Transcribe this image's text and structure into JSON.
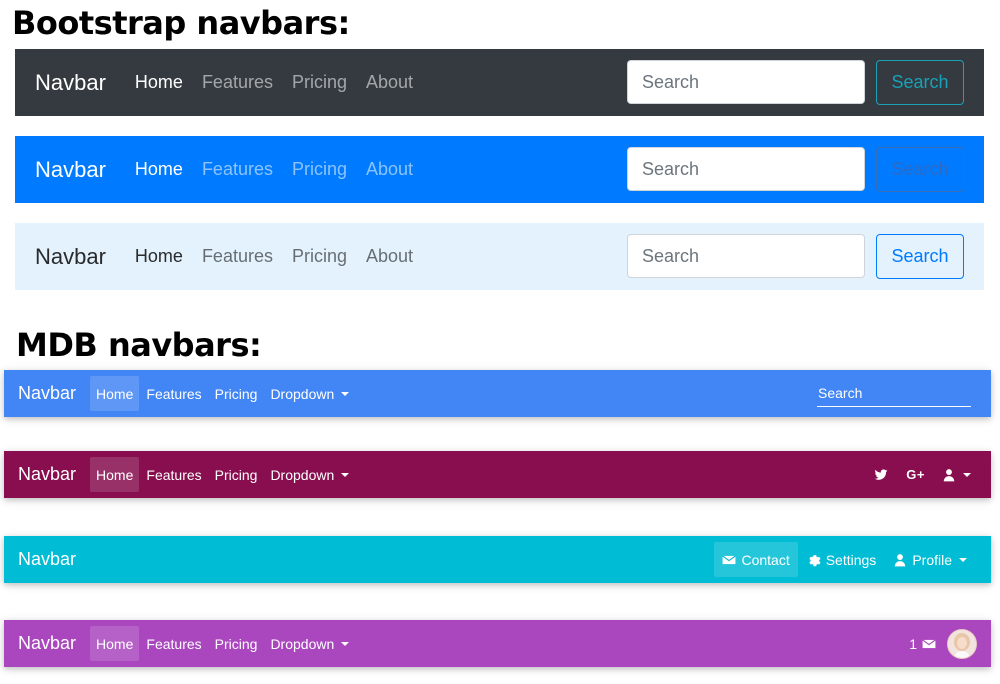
{
  "headings": {
    "bootstrap": "Bootstrap navbars:",
    "mdb": "MDB navbars:"
  },
  "bootstrap_navbars": [
    {
      "brand": "Navbar",
      "links": [
        "Home",
        "Features",
        "Pricing",
        "About"
      ],
      "search_placeholder": "Search",
      "search_button": "Search",
      "background": "#343a40"
    },
    {
      "brand": "Navbar",
      "links": [
        "Home",
        "Features",
        "Pricing",
        "About"
      ],
      "search_placeholder": "Search",
      "search_button": "Search",
      "background": "#007bff"
    },
    {
      "brand": "Navbar",
      "links": [
        "Home",
        "Features",
        "Pricing",
        "About"
      ],
      "search_placeholder": "Search",
      "search_button": "Search",
      "background": "#e3f2fd"
    }
  ],
  "mdb_navbars": [
    {
      "brand": "Navbar",
      "links": [
        "Home",
        "Features",
        "Pricing",
        "Dropdown"
      ],
      "search_placeholder": "Search",
      "background": "#4285f4"
    },
    {
      "brand": "Navbar",
      "links": [
        "Home",
        "Features",
        "Pricing",
        "Dropdown"
      ],
      "right_icons": [
        "twitter-icon",
        "google-plus-icon",
        "user-icon"
      ],
      "google_plus_text": "G+",
      "background": "#880e4f"
    },
    {
      "brand": "Navbar",
      "right_items": [
        "Contact",
        "Settings",
        "Profile"
      ],
      "background": "#00bcd4"
    },
    {
      "brand": "Navbar",
      "links": [
        "Home",
        "Features",
        "Pricing",
        "Dropdown"
      ],
      "badge_count": "1",
      "background": "#aa46be"
    }
  ]
}
